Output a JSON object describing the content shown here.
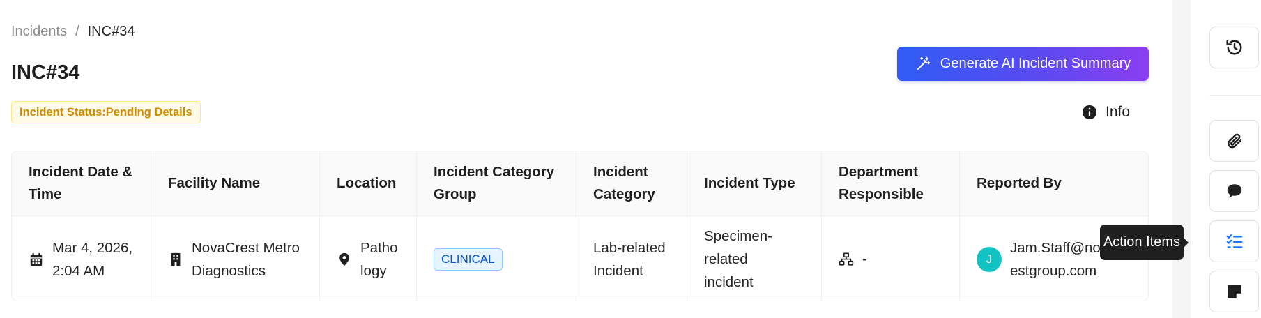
{
  "breadcrumb": {
    "parent": "Incidents",
    "separator": "/",
    "current": "INC#34"
  },
  "page": {
    "title": "INC#34"
  },
  "status": {
    "text": "Incident Status:Pending Details"
  },
  "actions": {
    "ai_summary_label": "Generate AI Incident Summary",
    "ai_summary_icon": "magic-wand-icon",
    "info_label": "Info",
    "info_icon": "info-circle-icon"
  },
  "table": {
    "headers": [
      "Incident Date & Time",
      "Facility Name",
      "Location",
      "Incident Category Group",
      "Incident Category",
      "Incident Type",
      "Department Responsible",
      "Reported By"
    ],
    "row": {
      "date_time": "Mar 4, 2026, 2:04 AM",
      "date_icon": "calendar-icon",
      "facility": "NovaCrest Metro Diagnostics",
      "facility_icon": "building-icon",
      "location": "Patho logy",
      "location_icon": "map-pin-icon",
      "category_group": "CLINICAL",
      "category": "Lab-related Incident",
      "type": "Specimen-related incident",
      "department": "-",
      "department_icon": "org-chart-icon",
      "reporter_initial": "J",
      "reporter": "Jam.Staff@novacrestgroup.com"
    }
  },
  "sidebar": {
    "buttons": [
      {
        "name": "history",
        "icon": "history-icon"
      },
      {
        "name": "attachments",
        "icon": "paperclip-icon"
      },
      {
        "name": "comments",
        "icon": "comment-icon"
      },
      {
        "name": "action-items",
        "icon": "checklist-icon"
      },
      {
        "name": "notes",
        "icon": "note-icon"
      }
    ],
    "tooltip": "Action Items"
  },
  "colors": {
    "status_bg": "#fffbe6",
    "status_text": "#d48806",
    "gradient_start": "#2f5cf5",
    "gradient_end": "#8b3ef0",
    "tag_blue": "#0958d9",
    "avatar": "#13c2c2",
    "active_icon": "#1677ff"
  }
}
